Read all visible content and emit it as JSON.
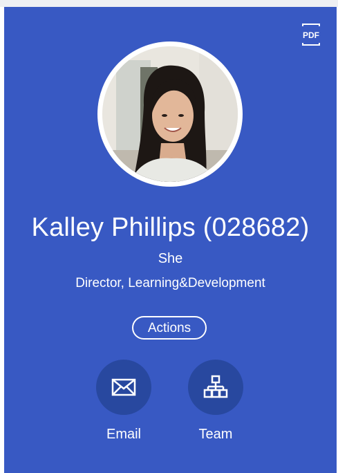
{
  "profile": {
    "name": "Kalley Phillips (028682)",
    "pronoun": "She",
    "title": "Director, Learning&Development"
  },
  "header": {
    "pdf_label": "PDF"
  },
  "actions": {
    "label": "Actions"
  },
  "quick_links": [
    {
      "label": "Email",
      "icon": "envelope-icon"
    },
    {
      "label": "Team",
      "icon": "org-chart-icon"
    }
  ],
  "colors": {
    "card_background": "#3859c3",
    "circle_button": "#28489f",
    "text": "#ffffff"
  }
}
